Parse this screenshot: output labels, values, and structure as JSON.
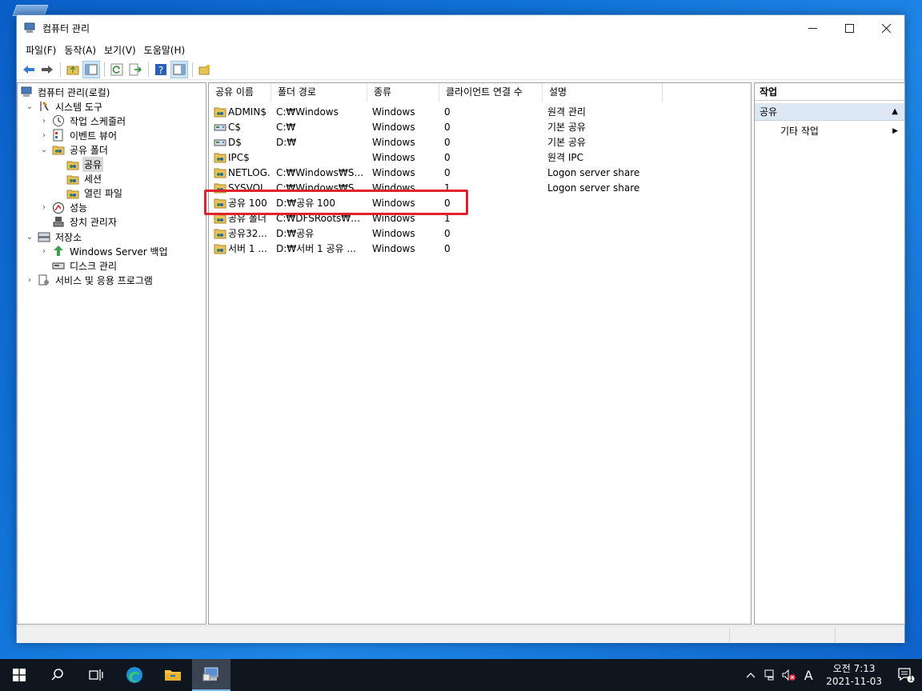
{
  "window": {
    "title": "컴퓨터 관리"
  },
  "menu": [
    "파일(F)",
    "동작(A)",
    "보기(V)",
    "도움말(H)"
  ],
  "tree": [
    {
      "label": "컴퓨터 관리(로컬)",
      "level": 0,
      "expander": "",
      "icon": "computer-management-icon"
    },
    {
      "label": "시스템 도구",
      "level": 1,
      "expander": "⌄",
      "icon": "system-tools-icon"
    },
    {
      "label": "작업 스케줄러",
      "level": 2,
      "expander": "›",
      "icon": "clock-icon"
    },
    {
      "label": "이벤트 뷰어",
      "level": 2,
      "expander": "›",
      "icon": "event-viewer-icon"
    },
    {
      "label": "공유 폴더",
      "level": 2,
      "expander": "⌄",
      "icon": "shared-folder-icon"
    },
    {
      "label": "공유",
      "level": 3,
      "expander": "",
      "icon": "share-icon",
      "selected": true
    },
    {
      "label": "세션",
      "level": 3,
      "expander": "",
      "icon": "session-icon"
    },
    {
      "label": "열린 파일",
      "level": 3,
      "expander": "",
      "icon": "open-files-icon"
    },
    {
      "label": "성능",
      "level": 2,
      "expander": "›",
      "icon": "performance-icon"
    },
    {
      "label": "장치 관리자",
      "level": 2,
      "expander": "",
      "icon": "device-manager-icon"
    },
    {
      "label": "저장소",
      "level": 1,
      "expander": "⌄",
      "icon": "storage-icon"
    },
    {
      "label": "Windows Server 백업",
      "level": 2,
      "expander": "›",
      "icon": "backup-icon"
    },
    {
      "label": "디스크 관리",
      "level": 2,
      "expander": "",
      "icon": "disk-management-icon"
    },
    {
      "label": "서비스 및 응용 프로그램",
      "level": 1,
      "expander": "›",
      "icon": "services-icon"
    }
  ],
  "list": {
    "columns": [
      "공유 이름",
      "폴더 경로",
      "종류",
      "클라이언트 연결 수",
      "설명"
    ],
    "rows": [
      {
        "name": "ADMIN$",
        "path": "C:₩Windows",
        "type": "Windows",
        "clients": "0",
        "desc": "원격 관리"
      },
      {
        "name": "C$",
        "path": "C:₩",
        "type": "Windows",
        "clients": "0",
        "desc": "기본 공유"
      },
      {
        "name": "D$",
        "path": "D:₩",
        "type": "Windows",
        "clients": "0",
        "desc": "기본 공유"
      },
      {
        "name": "IPC$",
        "path": "",
        "type": "Windows",
        "clients": "0",
        "desc": "원격 IPC"
      },
      {
        "name": "NETLOG...",
        "path": "C:₩Windows₩SYS...",
        "type": "Windows",
        "clients": "0",
        "desc": "Logon server share"
      },
      {
        "name": "SYSVOL",
        "path": "C:₩Windows₩SYS...",
        "type": "Windows",
        "clients": "1",
        "desc": "Logon server share"
      },
      {
        "name": "공유 100",
        "path": "D:₩공유 100",
        "type": "Windows",
        "clients": "0",
        "desc": ""
      },
      {
        "name": "공유 폴더",
        "path": "C:₩DFSRoots₩공...",
        "type": "Windows",
        "clients": "1",
        "desc": ""
      },
      {
        "name": "공유32...",
        "path": "D:₩공유",
        "type": "Windows",
        "clients": "0",
        "desc": ""
      },
      {
        "name": "서버 1 ...",
        "path": "D:₩서버 1 공유 ...",
        "type": "Windows",
        "clients": "0",
        "desc": ""
      }
    ]
  },
  "actions": {
    "header": "작업",
    "section": "공유",
    "item": "기타 작업"
  },
  "taskbar": {
    "time": "오전 7:13",
    "date": "2021-11-03",
    "ime": "A",
    "notif_count": "1"
  }
}
